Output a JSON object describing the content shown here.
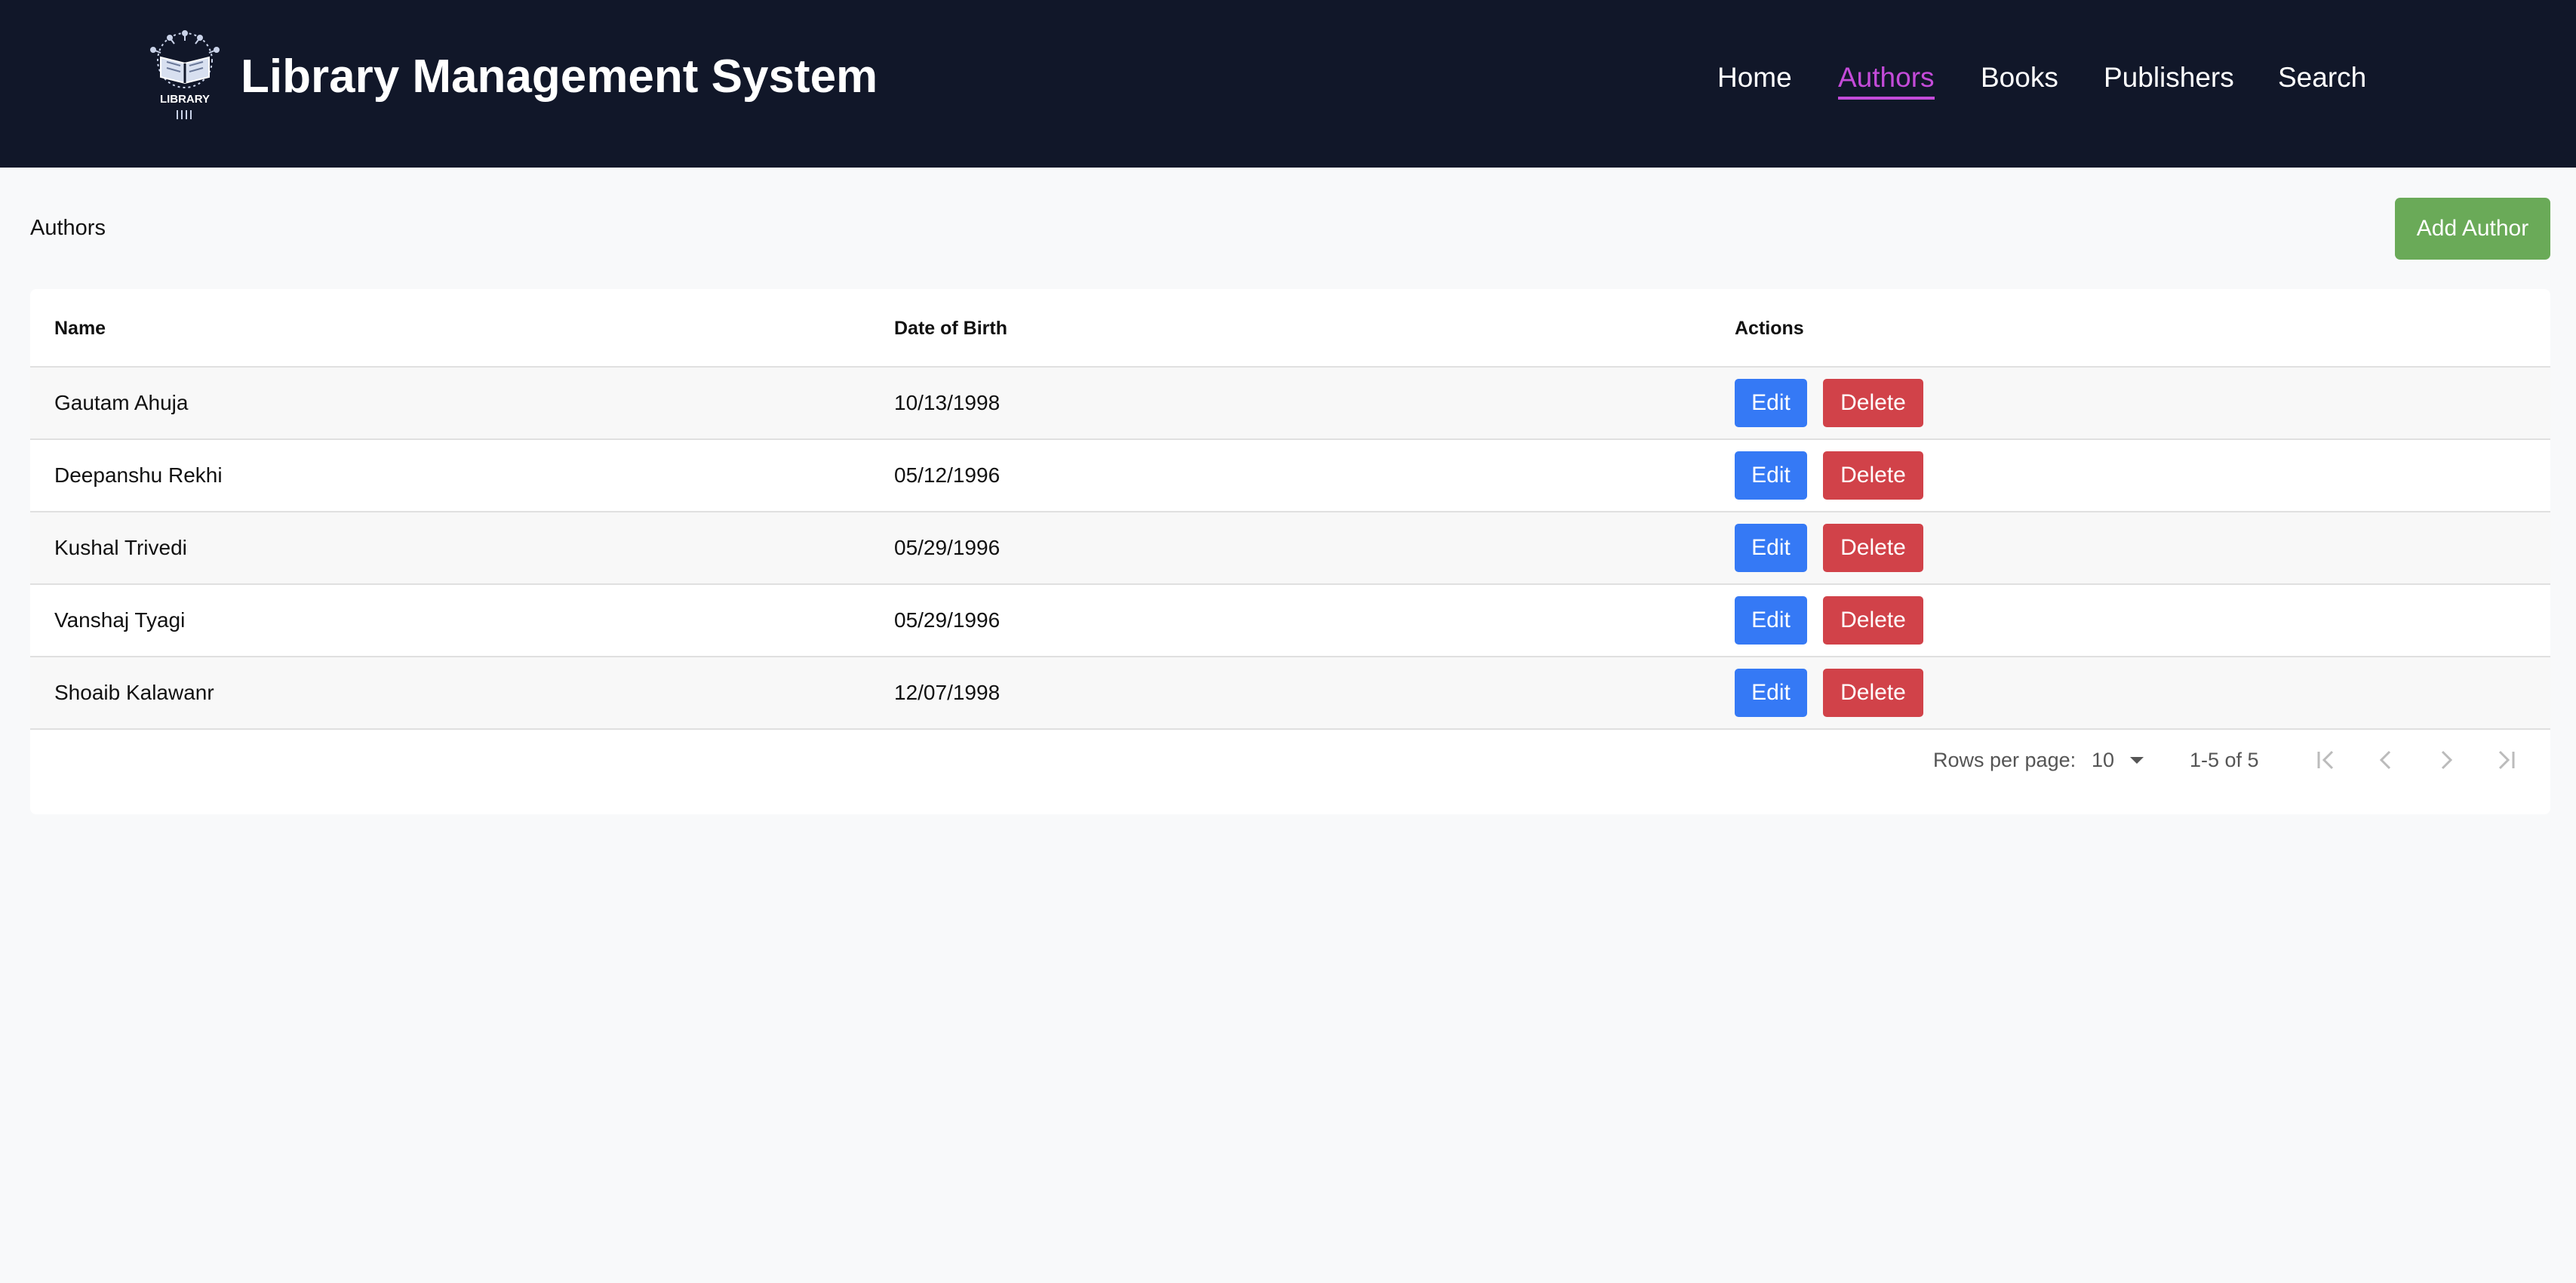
{
  "app": {
    "title": "Library Management System",
    "logo_text": "LIBRARY"
  },
  "nav": {
    "items": [
      {
        "label": "Home",
        "active": false
      },
      {
        "label": "Authors",
        "active": true
      },
      {
        "label": "Books",
        "active": false
      },
      {
        "label": "Publishers",
        "active": false
      },
      {
        "label": "Search",
        "active": false
      }
    ]
  },
  "page": {
    "heading": "Authors",
    "add_label": "Add Author"
  },
  "table": {
    "columns": [
      "Name",
      "Date of Birth",
      "Actions"
    ],
    "rows": [
      {
        "name": "Gautam Ahuja",
        "dob": "10/13/1998"
      },
      {
        "name": "Deepanshu Rekhi",
        "dob": "05/12/1996"
      },
      {
        "name": "Kushal Trivedi",
        "dob": "05/29/1996"
      },
      {
        "name": "Vanshaj Tyagi",
        "dob": "05/29/1996"
      },
      {
        "name": "Shoaib Kalawanr",
        "dob": "12/07/1998"
      }
    ],
    "edit_label": "Edit",
    "delete_label": "Delete"
  },
  "pagination": {
    "rows_per_page_label": "Rows per page:",
    "rows_per_page_value": "10",
    "range_text": "1-5 of 5"
  },
  "colors": {
    "navbar_bg": "#111729",
    "active_nav": "#c44bd9",
    "add_button": "#6aaa58",
    "edit_button": "#3579f5",
    "delete_button": "#d14249"
  },
  "icons": {
    "logo": "library-book-icon",
    "rows_dropdown": "caret-down-icon",
    "first_page": "first-page-icon",
    "prev_page": "chevron-left-icon",
    "next_page": "chevron-right-icon",
    "last_page": "last-page-icon"
  }
}
